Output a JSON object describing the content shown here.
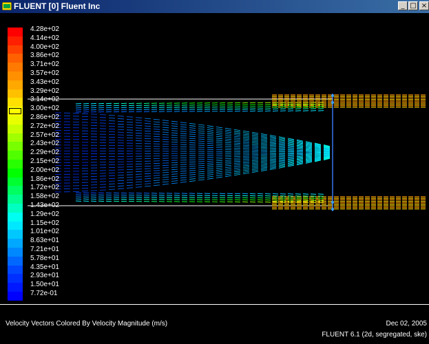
{
  "window": {
    "title": "FLUENT [0] Fluent Inc",
    "buttons": {
      "minimize": "_",
      "maximize": "□",
      "close": "×"
    }
  },
  "legend": {
    "labels": [
      "4.28e+02",
      "4.14e+02",
      "4.00e+02",
      "3.86e+02",
      "3.71e+02",
      "3.57e+02",
      "3.43e+02",
      "3.29e+02",
      "3.14e+02",
      "3.00e+02",
      "2.86e+02",
      "2.72e+02",
      "2.57e+02",
      "2.43e+02",
      "2.29e+02",
      "2.15e+02",
      "2.00e+02",
      "1.86e+02",
      "1.72e+02",
      "1.58e+02",
      "1.43e+02",
      "1.29e+02",
      "1.15e+02",
      "1.01e+02",
      "8.63e+01",
      "7.21e+01",
      "5.78e+01",
      "4.35e+01",
      "2.93e+01",
      "1.50e+01",
      "7.72e-01"
    ],
    "colors": [
      "#ff0000",
      "#ff2000",
      "#ff4000",
      "#ff6000",
      "#ff7a00",
      "#ff9000",
      "#ffa800",
      "#ffc000",
      "#ffe000",
      "#ffff00",
      "#e8ff00",
      "#c8ff00",
      "#a0ff00",
      "#78ff00",
      "#50ff00",
      "#28ff00",
      "#00ff00",
      "#00ff30",
      "#00ff60",
      "#00ff90",
      "#00ffc0",
      "#00fff0",
      "#00e8ff",
      "#00c8ff",
      "#00a8ff",
      "#0088ff",
      "#0068ff",
      "#0048ff",
      "#0030ff",
      "#0018ff",
      "#0000ff"
    ],
    "highlighted_index": 9,
    "units": "m/s"
  },
  "plot": {
    "caption": "Velocity Vectors Colored By Velocity Magnitude (m/s)",
    "date": "Dec 02, 2005",
    "version": "FLUENT 6.1 (2d, segregated, ske)",
    "accent_outline": "#ffffff"
  }
}
